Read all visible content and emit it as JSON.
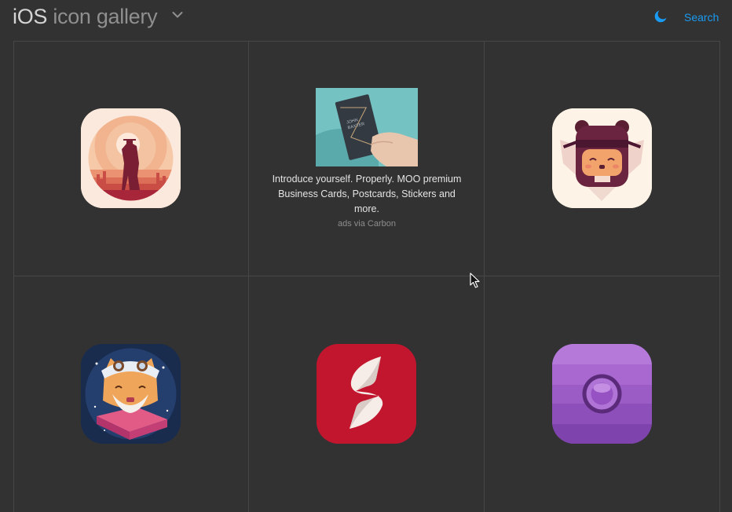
{
  "header": {
    "title_primary": "iOS",
    "title_secondary": "icon gallery",
    "dropdown_icon": "chevron-down-icon",
    "theme_icon": "moon-icon",
    "search_label": "Search"
  },
  "gallery": {
    "icons": [
      {
        "name": "desert-cowboy-app-icon",
        "row": 1,
        "col": 1
      },
      {
        "name": "ninja-creature-app-icon",
        "row": 1,
        "col": 3
      },
      {
        "name": "alchemist-cat-book-app-icon",
        "row": 2,
        "col": 1
      },
      {
        "name": "red-s-ribbon-app-icon",
        "row": 2,
        "col": 2
      },
      {
        "name": "purple-camera-lens-app-icon",
        "row": 2,
        "col": 3
      }
    ],
    "ad": {
      "card_name": "JOHN BAXTER",
      "text": "Introduce yourself. Properly. MOO premium Business Cards, Postcards, Stickers and more.",
      "via": "ads via Carbon"
    }
  },
  "colors": {
    "background": "#323232",
    "grid_line": "#474747",
    "accent": "#199bf3"
  }
}
